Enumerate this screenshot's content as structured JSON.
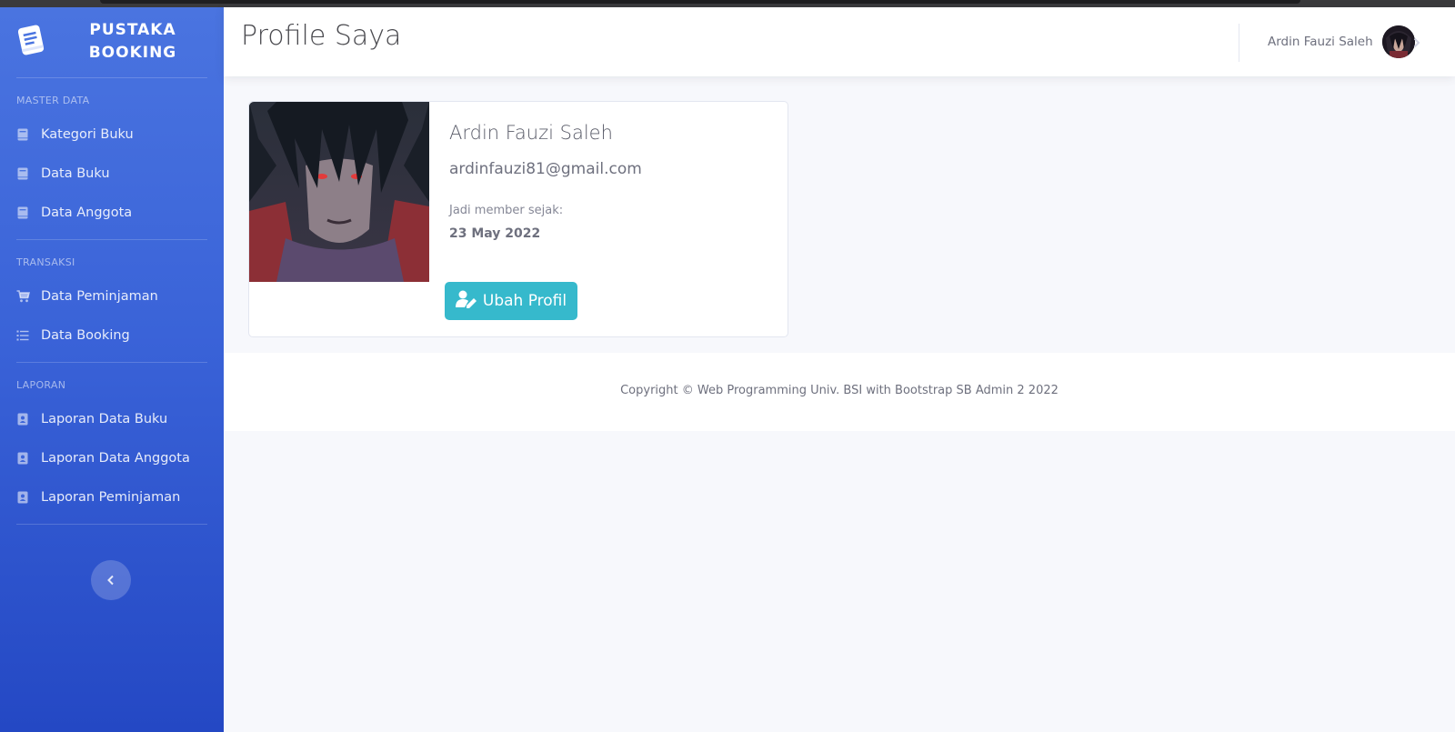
{
  "brand": {
    "line1": "PUSTAKA",
    "line2": "BOOKING",
    "logo_icon": "book-icon"
  },
  "sidebar": {
    "sections": [
      {
        "heading": "MASTER DATA",
        "items": [
          {
            "label": "Kategori Buku",
            "icon": "book-icon"
          },
          {
            "label": "Data Buku",
            "icon": "book-icon"
          },
          {
            "label": "Data Anggota",
            "icon": "book-icon"
          }
        ]
      },
      {
        "heading": "TRANSAKSI",
        "items": [
          {
            "label": "Data Peminjaman",
            "icon": "cart-icon"
          },
          {
            "label": "Data Booking",
            "icon": "list-icon"
          }
        ]
      },
      {
        "heading": "LAPORAN",
        "items": [
          {
            "label": "Laporan Data Buku",
            "icon": "address-book-icon"
          },
          {
            "label": "Laporan Data Anggota",
            "icon": "address-book-icon"
          },
          {
            "label": "Laporan Peminjaman",
            "icon": "address-book-icon"
          }
        ]
      }
    ],
    "toggle_icon": "chevron-left-icon"
  },
  "topbar": {
    "title": "Profile Saya",
    "user_name": "Ardin Fauzi Saleh"
  },
  "profile": {
    "name": "Ardin Fauzi Saleh",
    "email": "ardinfauzi81@gmail.com",
    "member_label": "Jadi member sejak:",
    "member_date": "23 May 2022",
    "edit_button": "Ubah Profil"
  },
  "footer": {
    "copyright": "Copyright © Web Programming Univ. BSI with Bootstrap SB Admin 2 2022"
  },
  "colors": {
    "sidebar_top": "#4a74e0",
    "sidebar_bottom": "#2448c4",
    "accent_info": "#36b9cc",
    "background": "#f7f8fc"
  }
}
